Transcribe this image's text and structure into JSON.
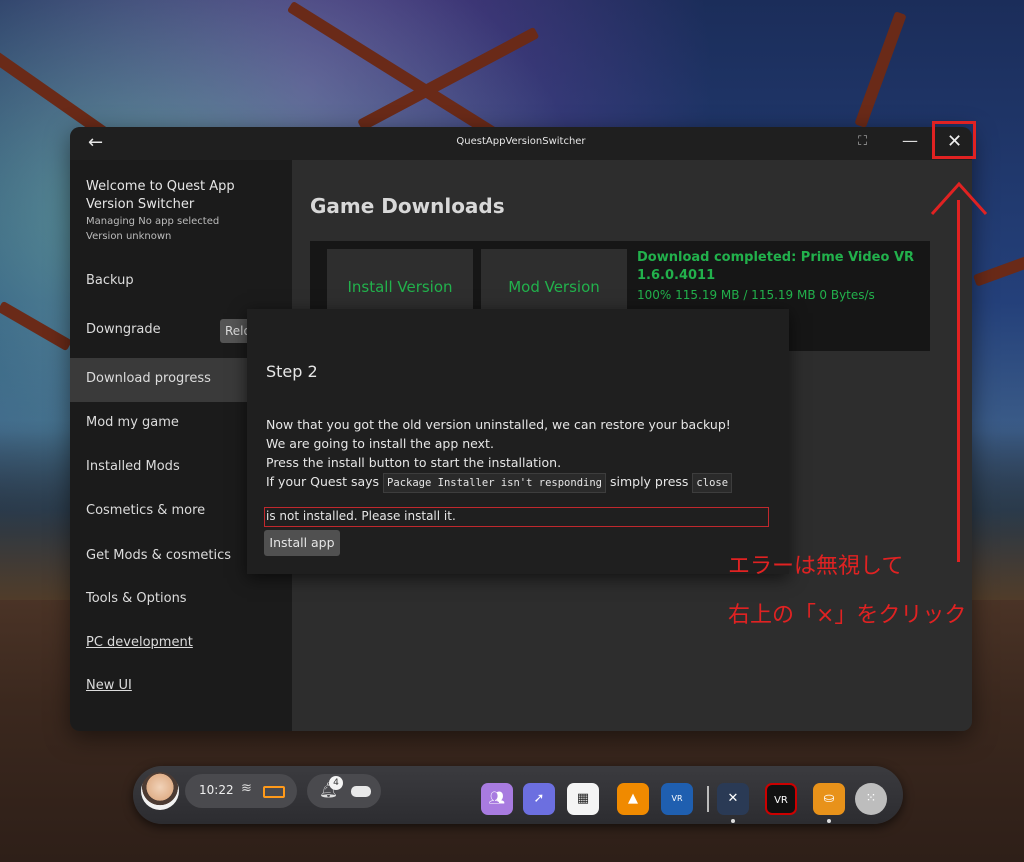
{
  "window": {
    "title": "QuestAppVersionSwitcher",
    "back_icon": "←",
    "expand_icon": "⛶",
    "minimize_icon": "—",
    "close_icon": "✕"
  },
  "sidebar": {
    "welcome_title": "Welcome to Quest App Version Switcher",
    "managing": "Managing No app selected",
    "version": "Version unknown",
    "reload_label": "Relo",
    "items": [
      {
        "label": "Backup"
      },
      {
        "label": "Downgrade"
      },
      {
        "label": "Download progress"
      },
      {
        "label": "Mod my game"
      },
      {
        "label": "Installed Mods"
      },
      {
        "label": "Cosmetics & more"
      },
      {
        "label": "Get Mods & cosmetics"
      },
      {
        "label": "Tools & Options"
      },
      {
        "label": "PC development"
      },
      {
        "label": "New UI"
      }
    ]
  },
  "main": {
    "heading": "Game Downloads",
    "install_version": "Install Version",
    "mod_version": "Mod Version",
    "download_status_title": "Download completed: Prime Video VR 1.6.0.4011",
    "download_progress": "100% 115.19 MB / 115.19 MB 0 Bytes/s"
  },
  "dialog": {
    "step": "Step 2",
    "line1": "Now that you got the old version uninstalled, we can restore your backup!",
    "line2": "We are going to install the app next.",
    "line3": "Press the install button to start the installation.",
    "line4_prefix": "If your Quest says",
    "line4_code1": "Package Installer isn't responding",
    "line4_mid": "simply press",
    "line4_code2": "close",
    "error": "is not installed. Please install it.",
    "install_button": "Install app"
  },
  "annotation": {
    "line1": "エラーは無視して",
    "line2": "右上の「×」をクリック",
    "color": "#e02222"
  },
  "dock": {
    "time": "10:22",
    "notification_count": "4",
    "wifi_icon": "≋"
  }
}
